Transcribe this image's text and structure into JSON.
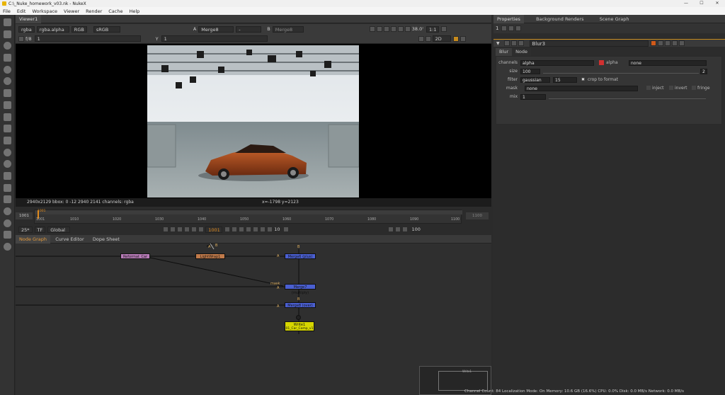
{
  "window": {
    "title": "C:\\_Nuke_homework_v03.nk - NukeX",
    "min": "—",
    "max": "☐",
    "close": "✕"
  },
  "menu": [
    "File",
    "Edit",
    "Workspace",
    "Viewer",
    "Render",
    "Cache",
    "Help"
  ],
  "viewer": {
    "tab": "Viewer1",
    "channels": "rgba",
    "layer": "rgba.alpha",
    "colorspace_dd": "RGB",
    "lut": "sRGB",
    "input_a": "Merge8",
    "input_b": "Merge8",
    "fstop_label": "f/8",
    "frame_value": "1",
    "y_label": "Y",
    "y_value": "1",
    "zoom": "38.0'",
    "ratio": "1:1",
    "mode": "2D",
    "a_label": "A",
    "b_label": "B",
    "dash": "-"
  },
  "info": {
    "format": "2940x2129  bbox: 0 -12 2940 2141 channels: rgba",
    "coords": "x=-1798 y=2123"
  },
  "timeline": {
    "start": "1001",
    "end": "1100",
    "ticks": [
      "1001",
      "1010",
      "1020",
      "1030",
      "1040",
      "1050",
      "1060",
      "1070",
      "1080",
      "1090",
      "1100"
    ],
    "current": "1001",
    "fps": "25*",
    "tf": "TF",
    "scope": "Global",
    "step": "10",
    "incr": "100",
    "marker": "1001"
  },
  "nodegraph": {
    "tabs": [
      "Node Graph",
      "Curve Editor",
      "Dope Sheet"
    ],
    "nodes": [
      {
        "label": "Reformat_Car",
        "color": "#b87cb8"
      },
      {
        "label": "LightWrap1",
        "color": "#c07a4a"
      },
      {
        "label": "Merge6 (plus)",
        "color": "#4a5fd0"
      },
      {
        "label": "Merge7 (multiply)",
        "color": "#4a5fd0"
      },
      {
        "label": "Merge8 (over)",
        "color": "#4a5fd0"
      },
      {
        "label": "Write1",
        "sub": "01_Car_Comp_v1",
        "color": "#d6d600"
      }
    ],
    "pins": {
      "A": "A",
      "B": "B",
      "mask": "mask"
    },
    "minimap_label": "Write1"
  },
  "properties": {
    "tabs": [
      "Properties",
      "Background Renders",
      "Scene Graph"
    ],
    "count": "1",
    "node_name": "Blur3",
    "subtabs": [
      "Blur",
      "Node"
    ],
    "channels_label": "channels",
    "channels_value": "alpha",
    "alpha_label": "alpha",
    "none_value": "none",
    "size_label": "size",
    "size_value": "100",
    "size_index": "2",
    "filter_label": "filter",
    "filter_value": "gaussian",
    "filter_quality": "15",
    "crop_label": "crop to format",
    "mask_label": "mask",
    "mask_value": "none",
    "inject_label": "inject",
    "invert_label": "invert",
    "fringe_label": "fringe",
    "mix_label": "mix",
    "mix_value": "1",
    "size_scale": [
      "0",
      "10",
      "20",
      "30",
      "40",
      "50",
      "60",
      "70",
      "80",
      "90",
      "100"
    ],
    "mix_scale": [
      "0",
      "0.1",
      "0.2",
      "0.3",
      "0.4",
      "0.5",
      "0.6",
      "0.7",
      "0.8",
      "0.9",
      "1"
    ]
  },
  "status": "Channel Count: 84  Localization Mode: On  Memory: 10.6 GB (16.6%)  CPU: 0.0%  Disk: 0.0 MB/s  Network: 0.0 MB/s"
}
